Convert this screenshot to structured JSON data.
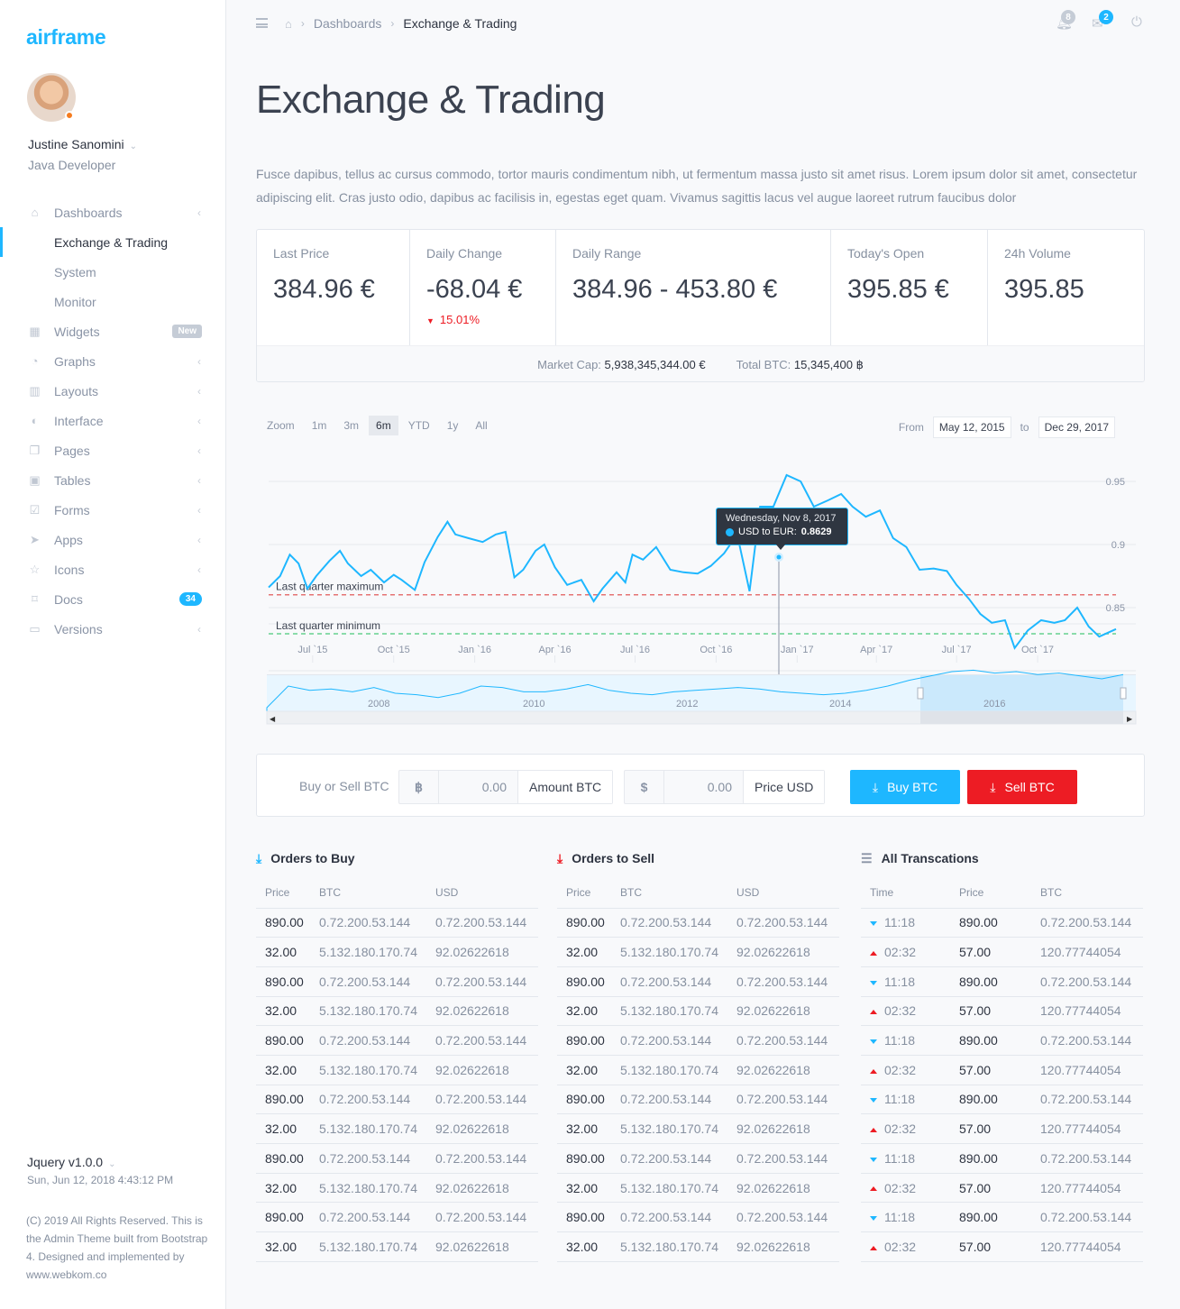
{
  "brand": {
    "logo": "airframe",
    "accent": "#1eb7ff"
  },
  "user": {
    "name": "Justine Sanomini",
    "role": "Java Developer",
    "status_color": "#f57c1f"
  },
  "sidebar": {
    "items": [
      {
        "label": "Dashboards",
        "icon": "home-icon",
        "arrow": "‹"
      },
      {
        "label": "Exchange & Trading",
        "sub": true,
        "active": true
      },
      {
        "label": "System",
        "sub": true
      },
      {
        "label": "Monitor",
        "sub": true
      },
      {
        "label": "Widgets",
        "icon": "th-large-icon",
        "badge": "New"
      },
      {
        "label": "Graphs",
        "icon": "pie-chart-icon",
        "arrow": "‹"
      },
      {
        "label": "Layouts",
        "icon": "columns-icon",
        "arrow": "‹"
      },
      {
        "label": "Interface",
        "icon": "toggle-icon",
        "arrow": "‹"
      },
      {
        "label": "Pages",
        "icon": "clone-icon",
        "arrow": "‹"
      },
      {
        "label": "Tables",
        "icon": "trello-icon",
        "arrow": "‹"
      },
      {
        "label": "Forms",
        "icon": "check-square-icon",
        "arrow": "‹"
      },
      {
        "label": "Apps",
        "icon": "mouse-pointer-icon",
        "arrow": "‹"
      },
      {
        "label": "Icons",
        "icon": "star-icon",
        "arrow": "‹"
      },
      {
        "label": "Docs",
        "icon": "bookmark-icon",
        "badge": "34"
      },
      {
        "label": "Versions",
        "icon": "folder-open-icon",
        "arrow": "‹"
      }
    ],
    "footer": {
      "version": "Jquery v1.0.0",
      "datetime": "Sun, Jun 12, 2018 4:43:12 PM",
      "copyright": "(C) 2019 All Rights Reserved. This is the Admin Theme built from Bootstrap 4. Designed and implemented by www.webkom.co"
    }
  },
  "topbar": {
    "breadcrumb": [
      "Dashboards",
      "Exchange & Trading"
    ],
    "notifications_count": "8",
    "messages_count": "2"
  },
  "page": {
    "title": "Exchange & Trading",
    "description": "Fusce dapibus, tellus ac cursus commodo, tortor mauris condimentum nibh, ut fermentum massa justo sit amet risus. Lorem ipsum dolor sit amet, consectetur adipiscing elit. Cras justo odio, dapibus ac facilisis in, egestas eget quam. Vivamus sagittis lacus vel augue laoreet rutrum faucibus dolor"
  },
  "stats": {
    "last_price": {
      "label": "Last Price",
      "value": "384.96 €"
    },
    "daily_change": {
      "label": "Daily Change",
      "value": "-68.04 €",
      "change": "15.01%"
    },
    "daily_range": {
      "label": "Daily Range",
      "value": "384.96 - 453.80 €"
    },
    "todays_open": {
      "label": "Today's Open",
      "value": "395.85 €"
    },
    "volume": {
      "label": "24h Volume",
      "value": "395.85"
    },
    "market_cap_label": "Market Cap:",
    "market_cap": "5,938,345,344.00 €",
    "total_btc_label": "Total BTC:",
    "total_btc": "15,345,400 ฿"
  },
  "chart_controls": {
    "zoom_label": "Zoom",
    "ranges": [
      "1m",
      "3m",
      "6m",
      "YTD",
      "1y",
      "All"
    ],
    "selected": "6m",
    "from_label": "From",
    "from": "May 12, 2015",
    "to_label": "to",
    "to": "Dec 29, 2017"
  },
  "tooltip": {
    "date": "Wednesday, Nov 8, 2017",
    "series": "USD to EUR:",
    "value": "0.8629"
  },
  "chart_data": {
    "type": "line",
    "title": "USD to EUR",
    "series": [
      {
        "name": "USD to EUR",
        "color": "#1eb7ff"
      }
    ],
    "x_ticks": [
      "Jul `15",
      "Oct `15",
      "Jan `16",
      "Apr `16",
      "Jul `16",
      "Oct `16",
      "Jan `17",
      "Apr `17",
      "Jul `17",
      "Oct `17"
    ],
    "y_ticks": [
      0.85,
      0.9,
      0.95
    ],
    "ylim": [
      0.81,
      0.96
    ],
    "xlim": [
      "2015-05-12",
      "2017-12-29"
    ],
    "plot_lines": [
      {
        "label": "Last quarter maximum",
        "value": 0.8602,
        "color": "#e57373"
      },
      {
        "label": "Last quarter minimum",
        "value": 0.8293,
        "color": "#66d18f"
      }
    ],
    "points": [
      [
        "2015-05-12",
        0.866
      ],
      [
        "2015-05-25",
        0.875
      ],
      [
        "2015-06-05",
        0.892
      ],
      [
        "2015-06-15",
        0.885
      ],
      [
        "2015-06-25",
        0.865
      ],
      [
        "2015-07-05",
        0.875
      ],
      [
        "2015-07-20",
        0.887
      ],
      [
        "2015-08-01",
        0.895
      ],
      [
        "2015-08-10",
        0.885
      ],
      [
        "2015-08-25",
        0.875
      ],
      [
        "2015-09-05",
        0.88
      ],
      [
        "2015-09-20",
        0.87
      ],
      [
        "2015-10-01",
        0.876
      ],
      [
        "2015-10-10",
        0.872
      ],
      [
        "2015-10-25",
        0.864
      ],
      [
        "2015-11-05",
        0.886
      ],
      [
        "2015-11-20",
        0.906
      ],
      [
        "2015-12-01",
        0.918
      ],
      [
        "2015-12-10",
        0.908
      ],
      [
        "2015-12-25",
        0.905
      ],
      [
        "2016-01-10",
        0.902
      ],
      [
        "2016-01-25",
        0.908
      ],
      [
        "2016-02-05",
        0.91
      ],
      [
        "2016-02-15",
        0.874
      ],
      [
        "2016-02-25",
        0.88
      ],
      [
        "2016-03-10",
        0.895
      ],
      [
        "2016-03-20",
        0.9
      ],
      [
        "2016-04-01",
        0.882
      ],
      [
        "2016-04-15",
        0.868
      ],
      [
        "2016-05-01",
        0.872
      ],
      [
        "2016-05-15",
        0.855
      ],
      [
        "2016-05-25",
        0.865
      ],
      [
        "2016-06-10",
        0.878
      ],
      [
        "2016-06-20",
        0.87
      ],
      [
        "2016-06-28",
        0.892
      ],
      [
        "2016-07-10",
        0.888
      ],
      [
        "2016-07-25",
        0.898
      ],
      [
        "2016-08-10",
        0.88
      ],
      [
        "2016-08-25",
        0.878
      ],
      [
        "2016-09-10",
        0.877
      ],
      [
        "2016-09-25",
        0.883
      ],
      [
        "2016-10-10",
        0.893
      ],
      [
        "2016-10-25",
        0.908
      ],
      [
        "2016-11-08",
        0.8629
      ],
      [
        "2016-11-20",
        0.93
      ],
      [
        "2016-12-05",
        0.93
      ],
      [
        "2016-12-20",
        0.955
      ],
      [
        "2017-01-05",
        0.95
      ],
      [
        "2017-01-20",
        0.93
      ],
      [
        "2017-02-05",
        0.935
      ],
      [
        "2017-02-20",
        0.94
      ],
      [
        "2017-03-05",
        0.93
      ],
      [
        "2017-03-20",
        0.922
      ],
      [
        "2017-04-05",
        0.927
      ],
      [
        "2017-04-20",
        0.905
      ],
      [
        "2017-05-05",
        0.898
      ],
      [
        "2017-05-20",
        0.88
      ],
      [
        "2017-06-05",
        0.881
      ],
      [
        "2017-06-20",
        0.879
      ],
      [
        "2017-07-01",
        0.868
      ],
      [
        "2017-07-15",
        0.857
      ],
      [
        "2017-07-28",
        0.845
      ],
      [
        "2017-08-10",
        0.838
      ],
      [
        "2017-08-25",
        0.84
      ],
      [
        "2017-09-05",
        0.818
      ],
      [
        "2017-09-20",
        0.832
      ],
      [
        "2017-10-05",
        0.84
      ],
      [
        "2017-10-20",
        0.838
      ],
      [
        "2017-11-01",
        0.84
      ],
      [
        "2017-11-15",
        0.85
      ],
      [
        "2017-11-28",
        0.835
      ],
      [
        "2017-12-10",
        0.827
      ],
      [
        "2017-12-29",
        0.833
      ]
    ],
    "navigator": {
      "x_ticks": [
        "2008",
        "2010",
        "2012",
        "2014",
        "2016"
      ],
      "selected_range": [
        "2015-05-12",
        "2017-12-29"
      ]
    }
  },
  "trade_form": {
    "label": "Buy or Sell BTC",
    "amount_prefix": "฿",
    "amount_value": "0.00",
    "amount_suffix": "Amount BTC",
    "price_prefix": "$",
    "price_value": "0.00",
    "price_suffix": "Price USD",
    "buy_label": "Buy BTC",
    "buy_color": "#1eb7ff",
    "sell_label": "Sell BTC",
    "sell_color": "#ed1c24"
  },
  "orders_buy": {
    "title": "Orders to Buy",
    "columns": [
      "Price",
      "BTC",
      "USD"
    ],
    "rows": [
      [
        "890.00",
        "0.72.200.53.144",
        "0.72.200.53.144"
      ],
      [
        "32.00",
        "5.132.180.170.74",
        "92.02622618"
      ],
      [
        "890.00",
        "0.72.200.53.144",
        "0.72.200.53.144"
      ],
      [
        "32.00",
        "5.132.180.170.74",
        "92.02622618"
      ],
      [
        "890.00",
        "0.72.200.53.144",
        "0.72.200.53.144"
      ],
      [
        "32.00",
        "5.132.180.170.74",
        "92.02622618"
      ],
      [
        "890.00",
        "0.72.200.53.144",
        "0.72.200.53.144"
      ],
      [
        "32.00",
        "5.132.180.170.74",
        "92.02622618"
      ],
      [
        "890.00",
        "0.72.200.53.144",
        "0.72.200.53.144"
      ],
      [
        "32.00",
        "5.132.180.170.74",
        "92.02622618"
      ],
      [
        "890.00",
        "0.72.200.53.144",
        "0.72.200.53.144"
      ],
      [
        "32.00",
        "5.132.180.170.74",
        "92.02622618"
      ]
    ]
  },
  "orders_sell": {
    "title": "Orders to Sell",
    "columns": [
      "Price",
      "BTC",
      "USD"
    ],
    "rows": [
      [
        "890.00",
        "0.72.200.53.144",
        "0.72.200.53.144"
      ],
      [
        "32.00",
        "5.132.180.170.74",
        "92.02622618"
      ],
      [
        "890.00",
        "0.72.200.53.144",
        "0.72.200.53.144"
      ],
      [
        "32.00",
        "5.132.180.170.74",
        "92.02622618"
      ],
      [
        "890.00",
        "0.72.200.53.144",
        "0.72.200.53.144"
      ],
      [
        "32.00",
        "5.132.180.170.74",
        "92.02622618"
      ],
      [
        "890.00",
        "0.72.200.53.144",
        "0.72.200.53.144"
      ],
      [
        "32.00",
        "5.132.180.170.74",
        "92.02622618"
      ],
      [
        "890.00",
        "0.72.200.53.144",
        "0.72.200.53.144"
      ],
      [
        "32.00",
        "5.132.180.170.74",
        "92.02622618"
      ],
      [
        "890.00",
        "0.72.200.53.144",
        "0.72.200.53.144"
      ],
      [
        "32.00",
        "5.132.180.170.74",
        "92.02622618"
      ]
    ]
  },
  "transactions": {
    "title": "All Transcations",
    "columns": [
      "Time",
      "Price",
      "BTC"
    ],
    "rows": [
      [
        "down",
        "11:18",
        "890.00",
        "0.72.200.53.144"
      ],
      [
        "up",
        "02:32",
        "57.00",
        "120.77744054"
      ],
      [
        "down",
        "11:18",
        "890.00",
        "0.72.200.53.144"
      ],
      [
        "up",
        "02:32",
        "57.00",
        "120.77744054"
      ],
      [
        "down",
        "11:18",
        "890.00",
        "0.72.200.53.144"
      ],
      [
        "up",
        "02:32",
        "57.00",
        "120.77744054"
      ],
      [
        "down",
        "11:18",
        "890.00",
        "0.72.200.53.144"
      ],
      [
        "up",
        "02:32",
        "57.00",
        "120.77744054"
      ],
      [
        "down",
        "11:18",
        "890.00",
        "0.72.200.53.144"
      ],
      [
        "up",
        "02:32",
        "57.00",
        "120.77744054"
      ],
      [
        "down",
        "11:18",
        "890.00",
        "0.72.200.53.144"
      ],
      [
        "up",
        "02:32",
        "57.00",
        "120.77744054"
      ]
    ]
  }
}
